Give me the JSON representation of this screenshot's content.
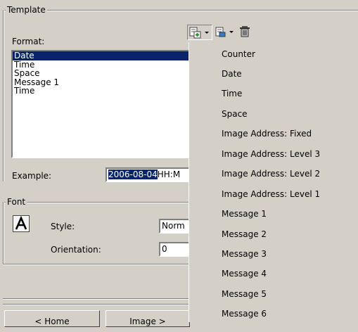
{
  "template": {
    "legend": "Template",
    "format_label": "Format:",
    "format_items": [
      "Date",
      "Time",
      "Space",
      "Message 1",
      "Time"
    ],
    "example_label": "Example:",
    "example_highlight": "2006-08-04",
    "example_rest": "HH:M"
  },
  "toolbar": {
    "add_icon": "add-field-icon",
    "edit_icon": "edit-field-icon",
    "delete_icon": "trash-icon"
  },
  "font": {
    "legend": "Font",
    "icon": "font-a-icon",
    "style_label": "Style:",
    "style_value": "Norm",
    "orientation_label": "Orientation:",
    "orientation_value": "0"
  },
  "menu": {
    "items": [
      "Counter",
      "Date",
      "Time",
      "Space",
      "Image Address: Fixed",
      "Image Address: Level 3",
      "Image Address: Level 2",
      "Image Address: Level 1",
      "Message 1",
      "Message 2",
      "Message 3",
      "Message 4",
      "Message 5",
      "Message 6"
    ]
  },
  "nav": {
    "home_label": "< Home",
    "image_label": "Image >"
  }
}
